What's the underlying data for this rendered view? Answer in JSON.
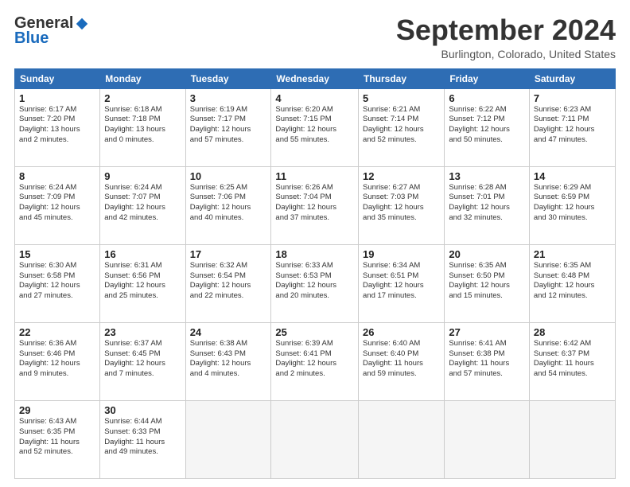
{
  "header": {
    "logo_general": "General",
    "logo_blue": "Blue",
    "month_title": "September 2024",
    "location": "Burlington, Colorado, United States"
  },
  "days_of_week": [
    "Sunday",
    "Monday",
    "Tuesday",
    "Wednesday",
    "Thursday",
    "Friday",
    "Saturday"
  ],
  "weeks": [
    [
      {
        "day": "1",
        "info": "Sunrise: 6:17 AM\nSunset: 7:20 PM\nDaylight: 13 hours\nand 2 minutes."
      },
      {
        "day": "2",
        "info": "Sunrise: 6:18 AM\nSunset: 7:18 PM\nDaylight: 13 hours\nand 0 minutes."
      },
      {
        "day": "3",
        "info": "Sunrise: 6:19 AM\nSunset: 7:17 PM\nDaylight: 12 hours\nand 57 minutes."
      },
      {
        "day": "4",
        "info": "Sunrise: 6:20 AM\nSunset: 7:15 PM\nDaylight: 12 hours\nand 55 minutes."
      },
      {
        "day": "5",
        "info": "Sunrise: 6:21 AM\nSunset: 7:14 PM\nDaylight: 12 hours\nand 52 minutes."
      },
      {
        "day": "6",
        "info": "Sunrise: 6:22 AM\nSunset: 7:12 PM\nDaylight: 12 hours\nand 50 minutes."
      },
      {
        "day": "7",
        "info": "Sunrise: 6:23 AM\nSunset: 7:11 PM\nDaylight: 12 hours\nand 47 minutes."
      }
    ],
    [
      {
        "day": "8",
        "info": "Sunrise: 6:24 AM\nSunset: 7:09 PM\nDaylight: 12 hours\nand 45 minutes."
      },
      {
        "day": "9",
        "info": "Sunrise: 6:24 AM\nSunset: 7:07 PM\nDaylight: 12 hours\nand 42 minutes."
      },
      {
        "day": "10",
        "info": "Sunrise: 6:25 AM\nSunset: 7:06 PM\nDaylight: 12 hours\nand 40 minutes."
      },
      {
        "day": "11",
        "info": "Sunrise: 6:26 AM\nSunset: 7:04 PM\nDaylight: 12 hours\nand 37 minutes."
      },
      {
        "day": "12",
        "info": "Sunrise: 6:27 AM\nSunset: 7:03 PM\nDaylight: 12 hours\nand 35 minutes."
      },
      {
        "day": "13",
        "info": "Sunrise: 6:28 AM\nSunset: 7:01 PM\nDaylight: 12 hours\nand 32 minutes."
      },
      {
        "day": "14",
        "info": "Sunrise: 6:29 AM\nSunset: 6:59 PM\nDaylight: 12 hours\nand 30 minutes."
      }
    ],
    [
      {
        "day": "15",
        "info": "Sunrise: 6:30 AM\nSunset: 6:58 PM\nDaylight: 12 hours\nand 27 minutes."
      },
      {
        "day": "16",
        "info": "Sunrise: 6:31 AM\nSunset: 6:56 PM\nDaylight: 12 hours\nand 25 minutes."
      },
      {
        "day": "17",
        "info": "Sunrise: 6:32 AM\nSunset: 6:54 PM\nDaylight: 12 hours\nand 22 minutes."
      },
      {
        "day": "18",
        "info": "Sunrise: 6:33 AM\nSunset: 6:53 PM\nDaylight: 12 hours\nand 20 minutes."
      },
      {
        "day": "19",
        "info": "Sunrise: 6:34 AM\nSunset: 6:51 PM\nDaylight: 12 hours\nand 17 minutes."
      },
      {
        "day": "20",
        "info": "Sunrise: 6:35 AM\nSunset: 6:50 PM\nDaylight: 12 hours\nand 15 minutes."
      },
      {
        "day": "21",
        "info": "Sunrise: 6:35 AM\nSunset: 6:48 PM\nDaylight: 12 hours\nand 12 minutes."
      }
    ],
    [
      {
        "day": "22",
        "info": "Sunrise: 6:36 AM\nSunset: 6:46 PM\nDaylight: 12 hours\nand 9 minutes."
      },
      {
        "day": "23",
        "info": "Sunrise: 6:37 AM\nSunset: 6:45 PM\nDaylight: 12 hours\nand 7 minutes."
      },
      {
        "day": "24",
        "info": "Sunrise: 6:38 AM\nSunset: 6:43 PM\nDaylight: 12 hours\nand 4 minutes."
      },
      {
        "day": "25",
        "info": "Sunrise: 6:39 AM\nSunset: 6:41 PM\nDaylight: 12 hours\nand 2 minutes."
      },
      {
        "day": "26",
        "info": "Sunrise: 6:40 AM\nSunset: 6:40 PM\nDaylight: 11 hours\nand 59 minutes."
      },
      {
        "day": "27",
        "info": "Sunrise: 6:41 AM\nSunset: 6:38 PM\nDaylight: 11 hours\nand 57 minutes."
      },
      {
        "day": "28",
        "info": "Sunrise: 6:42 AM\nSunset: 6:37 PM\nDaylight: 11 hours\nand 54 minutes."
      }
    ],
    [
      {
        "day": "29",
        "info": "Sunrise: 6:43 AM\nSunset: 6:35 PM\nDaylight: 11 hours\nand 52 minutes."
      },
      {
        "day": "30",
        "info": "Sunrise: 6:44 AM\nSunset: 6:33 PM\nDaylight: 11 hours\nand 49 minutes."
      },
      {
        "day": "",
        "info": ""
      },
      {
        "day": "",
        "info": ""
      },
      {
        "day": "",
        "info": ""
      },
      {
        "day": "",
        "info": ""
      },
      {
        "day": "",
        "info": ""
      }
    ]
  ]
}
